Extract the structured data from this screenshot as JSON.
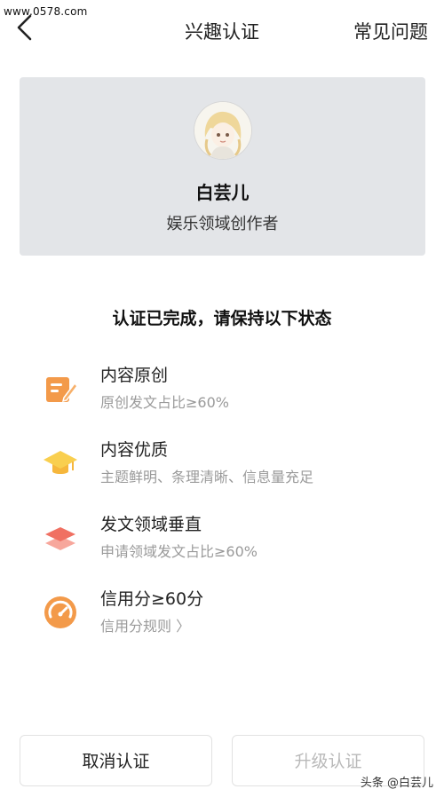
{
  "watermark": {
    "top": "www.0578.com",
    "bottom": "头条 @白芸儿"
  },
  "nav": {
    "title": "兴趣认证",
    "faq": "常见问题"
  },
  "profile": {
    "name": "白芸儿",
    "field": "娱乐领域创作者"
  },
  "status": {
    "title": "认证已完成，请保持以下状态"
  },
  "requirements": [
    {
      "title": "内容原创",
      "subtitle": "原创发文占比≥60%",
      "icon": "pen-paper-icon"
    },
    {
      "title": "内容优质",
      "subtitle": "主题鲜明、条理清晰、信息量充足",
      "icon": "graduation-cap-icon"
    },
    {
      "title": "发文领域垂直",
      "subtitle": "申请领域发文占比≥60%",
      "icon": "layers-icon"
    },
    {
      "title": "信用分≥60分",
      "subtitle": "信用分规则 〉",
      "icon": "gauge-icon"
    }
  ],
  "buttons": {
    "cancel": "取消认证",
    "upgrade": "升级认证"
  },
  "colors": {
    "orange": "#f39a4a",
    "yellow": "#f6c23e",
    "red": "#f07062",
    "card_bg": "#e3e5e8",
    "disabled_text": "#b9b9b9"
  }
}
